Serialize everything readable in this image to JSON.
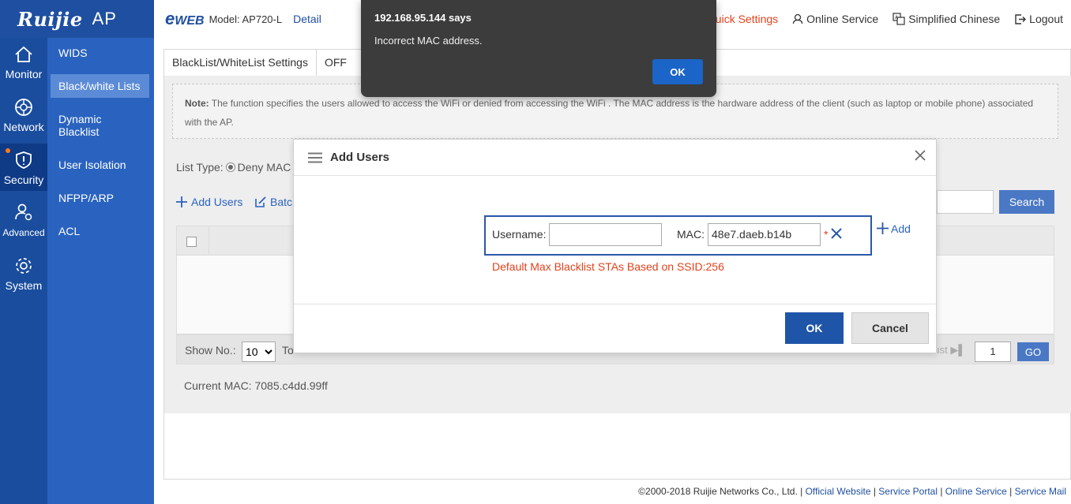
{
  "brand": {
    "logo": "Ruijie",
    "product": "AP"
  },
  "header": {
    "eweb": "EWEB",
    "model": "Model: AP720-L",
    "detail": "Detail",
    "quick_settings": "uick Settings",
    "online_service": "Online Service",
    "language": "Simplified Chinese",
    "logout": "Logout"
  },
  "rail": {
    "items": [
      {
        "label": "Monitor",
        "icon": "home-icon"
      },
      {
        "label": "Network",
        "icon": "globe-icon"
      },
      {
        "label": "Security",
        "icon": "shield-icon"
      },
      {
        "label": "Advanced",
        "icon": "user-gear-icon"
      },
      {
        "label": "System",
        "icon": "gear-icon"
      }
    ]
  },
  "subnav": {
    "items": [
      {
        "label": "WIDS"
      },
      {
        "label": "Black/white Lists"
      },
      {
        "label": "Dynamic Blacklist"
      },
      {
        "label": "User Isolation"
      },
      {
        "label": "NFPP/ARP"
      },
      {
        "label": "ACL"
      }
    ]
  },
  "tabs": {
    "settings": "BlackList/WhiteList Settings",
    "second": "OFF"
  },
  "note": {
    "prefix": "Note:",
    "text": " The function specifies the users allowed to access the WiFi or denied from accessing the WiFi . The MAC address is the hardware address of the client (such as laptop or mobile phone) associated with the AP."
  },
  "list_type": {
    "label": "List Type:",
    "option": "Deny MAC"
  },
  "actions": {
    "add_users": "Add Users",
    "batch": "Batc"
  },
  "search": {
    "button": "Search"
  },
  "pager": {
    "show_label": "Show No.:",
    "show_value": "10",
    "to": "To",
    "last": "ıst",
    "page": "1",
    "go": "GO"
  },
  "current_mac": "Current MAC: 7085.c4dd.99ff",
  "footer": {
    "copyright": "©2000-2018 Ruijie Networks Co., Ltd. | ",
    "official_website": "Official Website",
    "service_portal": "Service Portal",
    "online_service": "Online Service",
    "service_mail": "Service Mail",
    "sep": " | "
  },
  "modal": {
    "title": "Add Users",
    "username_label": "Username:",
    "username_value": "",
    "mac_label": "MAC:",
    "mac_value": "48e7.daeb.b14b",
    "required": "*",
    "add": "Add",
    "max_note": "Default Max Blacklist STAs Based on SSID:256",
    "ok": "OK",
    "cancel": "Cancel"
  },
  "alert": {
    "from": "192.168.95.144 says",
    "message": "Incorrect MAC address.",
    "ok": "OK"
  },
  "colors": {
    "brand_blue": "#1f4fa0",
    "accent_orange": "#e2421b",
    "button_blue": "#1f55a8"
  }
}
